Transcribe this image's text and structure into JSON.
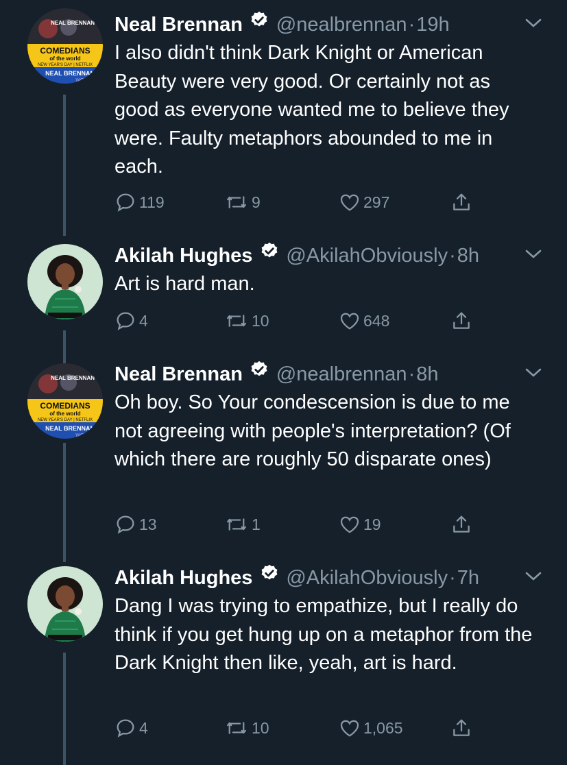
{
  "tweets": [
    {
      "name": "Neal Brennan",
      "handle": "@nealbrennan",
      "time": "19h",
      "text": "I also didn't think Dark Knight or American Beauty were very good.  Or certainly not as good as everyone wanted me to believe they were.  Faulty metaphors abounded to me in each.",
      "replies": "119",
      "retweets": "9",
      "likes": "297",
      "avatar": {
        "top": "NEAL BRENNAN",
        "line1": "COMEDIANS",
        "line2": "of the world",
        "line3": "NEW YEAR'S DAY | NETFLIX",
        "bottom": "NEAL BRENNAN",
        "bottom2": "WOMEN"
      }
    },
    {
      "name": "Akilah Hughes",
      "handle": "@AkilahObviously",
      "time": "8h",
      "text": "Art is hard man.",
      "replies": "4",
      "retweets": "10",
      "likes": "648"
    },
    {
      "name": "Neal Brennan",
      "handle": "@nealbrennan",
      "time": "8h",
      "text": "Oh boy. So Your condescension is due to me not agreeing with people's interpretation? (Of which there are roughly 50 disparate ones)",
      "replies": "13",
      "retweets": "1",
      "likes": "19",
      "avatar": {
        "top": "NEAL BRENNAN",
        "line1": "COMEDIANS",
        "line2": "of the world",
        "line3": "NEW YEAR'S DAY | NETFLIX",
        "bottom": "NEAL BRENNAN",
        "bottom2": "WOMEN"
      }
    },
    {
      "name": "Akilah Hughes",
      "handle": "@AkilahObviously",
      "time": "7h",
      "text": "Dang I was trying to empathize, but I really do think if you get hung up on a metaphor from the Dark Knight then like, yeah, art is hard.",
      "replies": "4",
      "retweets": "10",
      "likes": "1,065"
    }
  ],
  "colors": {
    "background": "#15202b",
    "muted": "#8899a6",
    "thread_line": "#3d5466",
    "poster_yellow": "#f5c518",
    "poster_blue": "#1f4fb0",
    "avatar_bg": "#cfe5d3",
    "shirt_green": "#1f7a4a"
  },
  "icons": [
    "verified-badge-icon",
    "chevron-down-icon",
    "reply-icon",
    "retweet-icon",
    "like-icon",
    "share-icon"
  ]
}
